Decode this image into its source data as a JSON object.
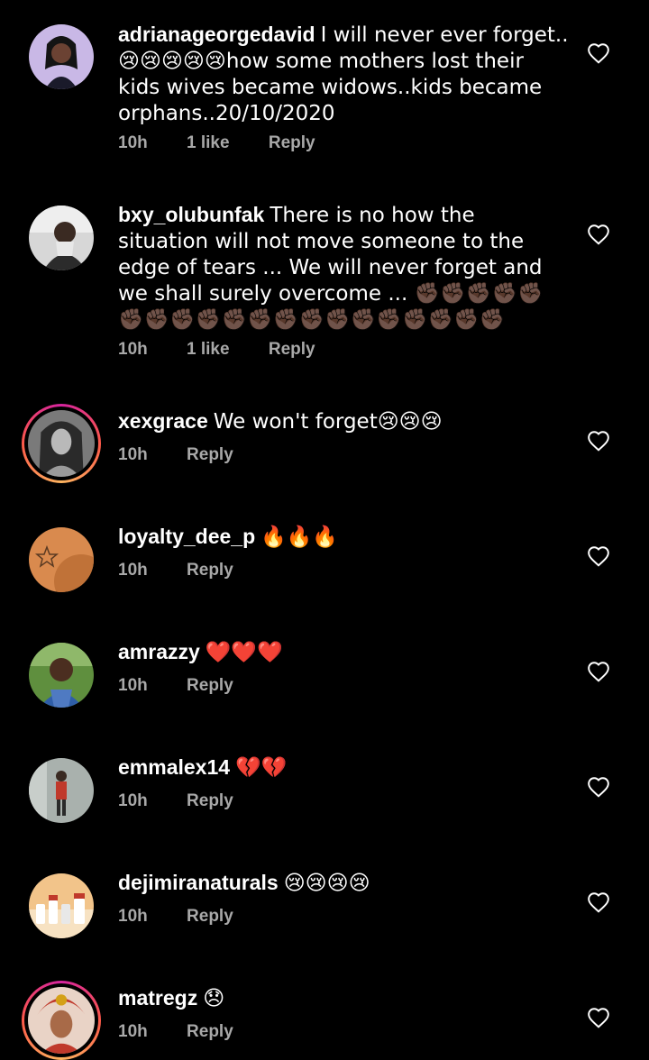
{
  "comments": [
    {
      "username": "adrianageorgedavid",
      "text": "I will never ever forget.. 😢😢😢😢😢how some mothers lost their kids wives became widows..kids became orphans..20/10/2020",
      "time": "10h",
      "likes": "1 like",
      "reply": "Reply",
      "has_story_ring": false
    },
    {
      "username": "bxy_olubunfak",
      "text": "There is no how the situation will not move someone to the edge of tears ... We will never forget and we shall surely overcome ... ✊🏿✊🏿✊🏿✊🏿✊🏿✊🏿✊🏿✊🏿✊🏿✊🏿✊🏿✊🏿✊🏿✊🏿✊🏿✊🏿✊🏿✊🏿✊🏿✊🏿",
      "time": "10h",
      "likes": "1 like",
      "reply": "Reply",
      "has_story_ring": false
    },
    {
      "username": "xexgrace",
      "text": "We won't forget😢😢😢",
      "time": "10h",
      "likes": "",
      "reply": "Reply",
      "has_story_ring": true
    },
    {
      "username": "loyalty_dee_p",
      "text": "🔥🔥🔥",
      "time": "10h",
      "likes": "",
      "reply": "Reply",
      "has_story_ring": false
    },
    {
      "username": "amrazzy",
      "text": "❤️❤️❤️",
      "time": "10h",
      "likes": "",
      "reply": "Reply",
      "has_story_ring": false
    },
    {
      "username": "emmalex14",
      "text": "💔💔",
      "time": "10h",
      "likes": "",
      "reply": "Reply",
      "has_story_ring": false
    },
    {
      "username": "dejimiranaturals",
      "text": "😢😢😢😢",
      "time": "10h",
      "likes": "",
      "reply": "Reply",
      "has_story_ring": false
    },
    {
      "username": "matregz",
      "text": "😞",
      "time": "10h",
      "likes": "",
      "reply": "Reply",
      "has_story_ring": true
    }
  ],
  "icons": {
    "like": "heart-outline-icon"
  },
  "colors": {
    "background": "#000000",
    "meta_text": "#a8a8a8",
    "story_ring_start": "#d6249f",
    "story_ring_end": "#fdb45f"
  }
}
